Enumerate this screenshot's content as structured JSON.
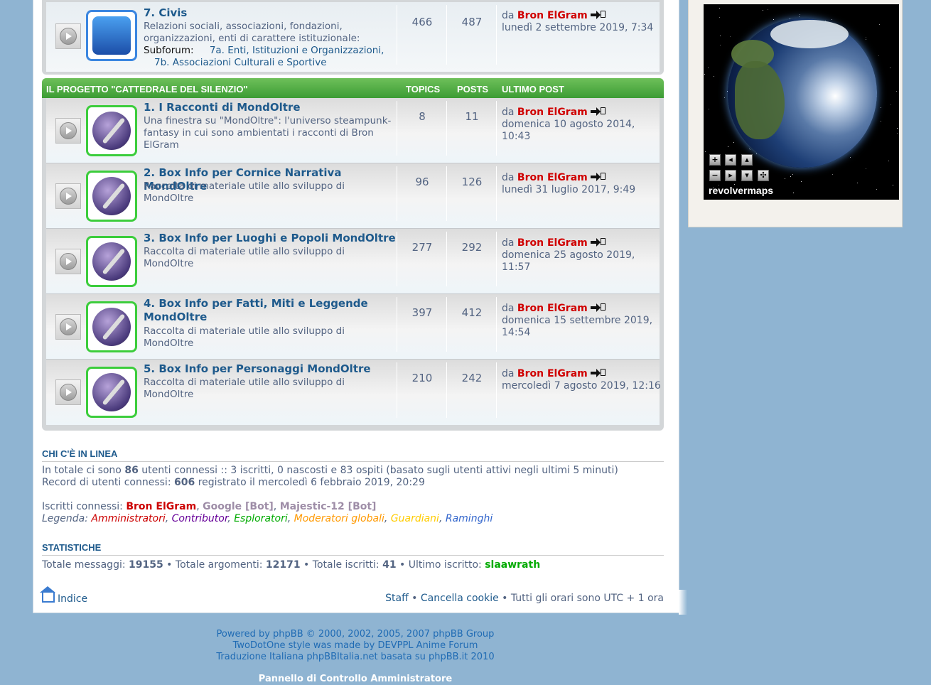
{
  "colors": {
    "accent": "#1e5a8c",
    "header_green": "#4cae3c",
    "admin_red": "#d00000",
    "background": "#8fb4d2"
  },
  "civis": {
    "title": "7. Civis",
    "desc": "Relazioni sociali, associazioni, fondazioni, organizzazioni, enti di carattere istituzionale:",
    "subforum_label": "Subforum:",
    "sub1": "7a. Enti, Istituzioni e Organizzazioni,",
    "sub2": "7b. Associazioni Culturali e Sportive",
    "topics": "466",
    "posts": "487",
    "last_by": "da",
    "last_user": "Bron ElGram",
    "last_date": "lunedì 2 settembre 2019, 7:34"
  },
  "category": {
    "name": "IL PROGETTO \"CATTEDRALE DEL SILENZIO\"",
    "col_topics": "TOPICS",
    "col_posts": "POSTS",
    "col_last": "ULTIMO POST"
  },
  "forums": [
    {
      "title": "1. I Racconti di MondOltre",
      "desc": "Una finestra su \"MondOltre\": l'universo steampunk-fantasy in cui sono ambientati i racconti di Bron ElGram",
      "topics": "8",
      "posts": "11",
      "by": "da",
      "user": "Bron ElGram",
      "date": "domenica 10 agosto 2014, 10:43"
    },
    {
      "title": "2. Box Info per Cornice Narrativa MondOltre",
      "desc": "Raccolta di materiale utile allo sviluppo di MondOltre",
      "topics": "96",
      "posts": "126",
      "by": "da",
      "user": "Bron ElGram",
      "date": "lunedì 31 luglio 2017, 9:49"
    },
    {
      "title": "3. Box Info per Luoghi e Popoli MondOltre",
      "desc": "Raccolta di materiale utile allo sviluppo di MondOltre",
      "topics": "277",
      "posts": "292",
      "by": "da",
      "user": "Bron ElGram",
      "date": "domenica 25 agosto 2019, 11:57"
    },
    {
      "title": "4. Box Info per Fatti, Miti e Leggende MondOltre",
      "desc": "Raccolta di materiale utile allo sviluppo di MondOltre",
      "topics": "397",
      "posts": "412",
      "by": "da",
      "user": "Bron ElGram",
      "date": "domenica 15 settembre 2019, 14:54"
    },
    {
      "title": "5. Box Info per Personaggi MondOltre",
      "desc": "Raccolta di materiale utile allo sviluppo di MondOltre",
      "topics": "210",
      "posts": "242",
      "by": "da",
      "user": "Bron ElGram",
      "date": "mercoledì 7 agosto 2019, 12:16"
    }
  ],
  "online": {
    "title": "CHI C'È IN LINEA",
    "line1_a": "In totale ci sono",
    "line1_count": "86",
    "line1_b": "utenti connessi :: 3 iscritti, 0 nascosti e 83 ospiti (basato sugli utenti attivi negli ultimi 5 minuti)",
    "line2_a": "Record di utenti connessi:",
    "line2_count": "606",
    "line2_b": "registrato il mercoledì 6 febbraio 2019, 20:29",
    "registered_label": "Iscritti connessi:",
    "user1": "Bron ElGram",
    "user2": "Google [Bot]",
    "user3": "Majestic-12 [Bot]",
    "legend_label": "Legenda:",
    "legend": [
      "Amministratori",
      "Contributor",
      "Esploratori",
      "Moderatori globali",
      "Guardiani",
      "Raminghi"
    ]
  },
  "stats": {
    "title": "STATISTICHE",
    "msgs_label": "Totale messaggi:",
    "msgs": "19155",
    "topics_label": "Totale argomenti:",
    "topics": "12171",
    "users_label": "Totale iscritti:",
    "users": "41",
    "newest_label": "Ultimo iscritto:",
    "newest": "slaawrath"
  },
  "footer": {
    "home": "Indice",
    "staff": "Staff",
    "cookies": "Cancella cookie",
    "timezone": "Tutti gli orari sono UTC + 1 ora",
    "powered1": "Powered by phpBB © 2000, 2002, 2005, 2007 phpBB Group",
    "powered2": "TwoDotOne style was made by DEVPPL Anime Forum",
    "powered3": "Traduzione Italiana phpBBItalia.net basata su phpBB.it 2010",
    "acp": "Pannello di Controllo Amministratore"
  },
  "map": {
    "label": "revolvermaps",
    "icons": [
      "zoom-in-icon",
      "zoom-out-icon",
      "arrow-left-icon",
      "arrow-right-icon",
      "arrow-up-icon",
      "arrow-down-icon",
      "center-icon"
    ]
  }
}
